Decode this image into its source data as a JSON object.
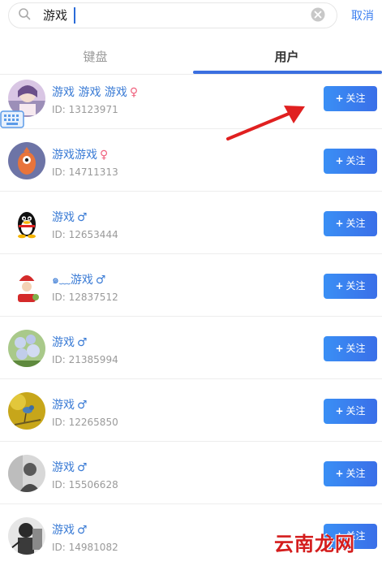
{
  "search": {
    "value": "游戏",
    "cancel_label": "取消"
  },
  "tabs": [
    {
      "label": "键盘",
      "active": false
    },
    {
      "label": "用户",
      "active": true
    }
  ],
  "users": [
    {
      "name": "游戏 游戏 游戏",
      "gender": "female",
      "gender_symbol": "♀",
      "id": "ID: 13123971",
      "follow_label": "关注",
      "avatar_color": "#c9b3d6"
    },
    {
      "name": "游戏游戏",
      "gender": "female",
      "gender_symbol": "♀",
      "id": "ID: 14711313",
      "follow_label": "关注",
      "avatar_color": "#6d74a6"
    },
    {
      "name": "游戏",
      "gender": "male",
      "gender_symbol": "♂",
      "id": "ID: 12653444",
      "follow_label": "关注",
      "avatar_color": "#ffffff"
    },
    {
      "name": "๑﹏游戏",
      "gender": "male",
      "gender_symbol": "♂",
      "id": "ID: 12837512",
      "follow_label": "关注",
      "avatar_color": "#ffffff"
    },
    {
      "name": "游戏",
      "gender": "male",
      "gender_symbol": "♂",
      "id": "ID: 21385994",
      "follow_label": "关注",
      "avatar_color": "#8fb36c"
    },
    {
      "name": "游戏",
      "gender": "male",
      "gender_symbol": "♂",
      "id": "ID: 12265850",
      "follow_label": "关注",
      "avatar_color": "#c7a61a"
    },
    {
      "name": "游戏",
      "gender": "male",
      "gender_symbol": "♂",
      "id": "ID: 15506628",
      "follow_label": "关注",
      "avatar_color": "#9a9a9a"
    },
    {
      "name": "游戏",
      "gender": "male",
      "gender_symbol": "♂",
      "id": "ID: 14981082",
      "follow_label": "关注",
      "avatar_color": "#3a3a3a"
    }
  ],
  "watermark": "云南龙网",
  "colors": {
    "accent": "#3b7ff0",
    "female": "#f0637f",
    "arrow": "#e02020"
  }
}
